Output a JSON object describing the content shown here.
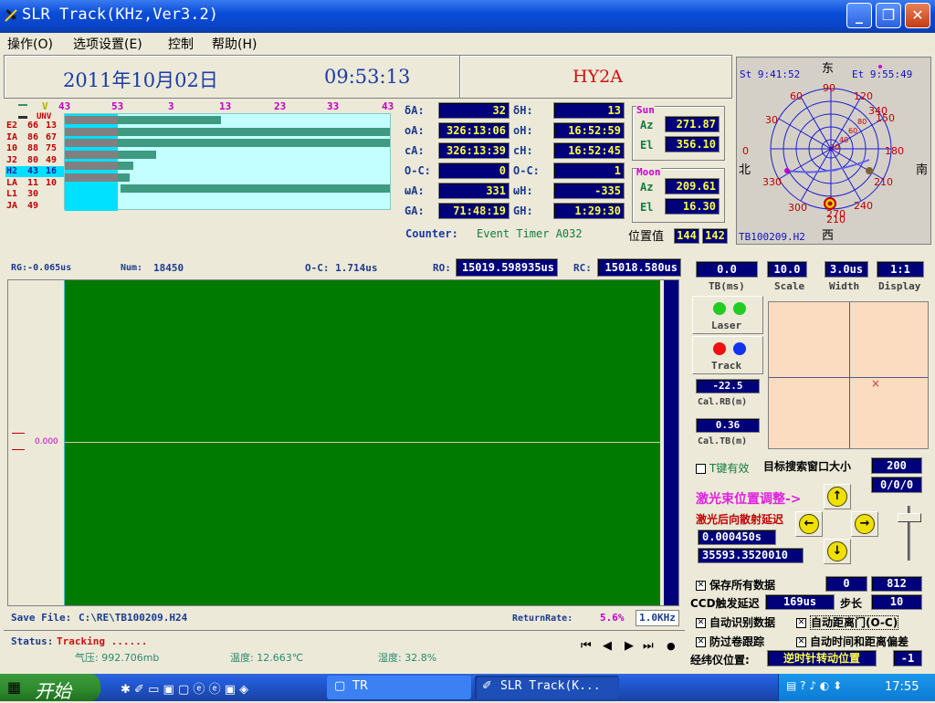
{
  "window": {
    "title": "SLR Track(KHz,Ver3.2)"
  },
  "menu": [
    "操作(O)",
    "选项设置(E)",
    "控制",
    "帮助(H)"
  ],
  "header": {
    "date": "2011年10月02日",
    "time": "09:53:13",
    "satellite": "HY2A"
  },
  "stations": {
    "col_v": "V",
    "col_unv": "UNV",
    "scale_labels": [
      "43",
      "53",
      "3",
      "13",
      "23",
      "33",
      "43"
    ],
    "rows": [
      {
        "name": "E2",
        "v": "66",
        "unv": "13",
        "bar": 0.48,
        "bar2": 0.0,
        "sel": false
      },
      {
        "name": "IA",
        "v": "86",
        "unv": "67",
        "bar": 1.0,
        "bar2": 0.0,
        "sel": false
      },
      {
        "name": "10",
        "v": "88",
        "unv": "75",
        "bar": 1.0,
        "bar2": 0.0,
        "sel": false
      },
      {
        "name": "J2",
        "v": "80",
        "unv": "49",
        "bar": 0.28,
        "bar2": 0.0,
        "sel": false
      },
      {
        "name": "H2",
        "v": "43",
        "unv": "16",
        "bar": 0.21,
        "bar2": 0.0,
        "sel": true
      },
      {
        "name": "LA",
        "v": "11",
        "unv": "10",
        "bar": 0.2,
        "bar2": 0.0,
        "sel": false
      },
      {
        "name": "L1",
        "v": "30",
        "unv": "",
        "bar": 0.0,
        "bar2": 0.83,
        "sel": false
      },
      {
        "name": "JA",
        "v": "49",
        "unv": "",
        "bar": 0.0,
        "bar2": 0.0,
        "sel": false
      }
    ]
  },
  "params": {
    "dA_label": "δA:",
    "dA": "32",
    "dH_label": "δH:",
    "dH": "13",
    "oA_label": "oA:",
    "oA": "326:13:06",
    "oH_label": "oH:",
    "oH": "16:52:59",
    "cA_label": "cA:",
    "cA": "326:13:39",
    "cH_label": "cH:",
    "cH": "16:52:45",
    "oc1_label": "O-C:",
    "oc1": "0",
    "oc2_label": "O-C:",
    "oc2": "1",
    "wA_label": "ωA:",
    "wA": "331",
    "wH_label": "ωH:",
    "wH": "-335",
    "GA_label": "GA:",
    "GA": "71:48:19",
    "GH_label": "GH:",
    "GH": "1:29:30",
    "counter_label": "Counter:",
    "counter_value": "Event Timer A032",
    "pos_label": "位置值",
    "pos1": "144",
    "pos2": "142"
  },
  "sun": {
    "label": "Sun",
    "az_label": "Az",
    "az": "271.87",
    "el_label": "El",
    "el": "356.10"
  },
  "moon": {
    "label": "Moon",
    "az_label": "Az",
    "az": "209.61",
    "el_label": "El",
    "el": "16.30"
  },
  "polar": {
    "start": "St  9:41:52",
    "end": "Et  9:55:49",
    "east": "东",
    "west": "西",
    "north": "北",
    "south": "南",
    "file": "TB100209.H2",
    "labels": [
      "90",
      "120",
      "60",
      "150",
      "30",
      "340",
      "180",
      "0",
      "210",
      "330",
      "300",
      "270",
      "240",
      "210",
      "80",
      "60",
      "40",
      "20"
    ]
  },
  "rangebar": {
    "rg": "RG:-0.065us",
    "num_label": "Num:",
    "num": "18450",
    "oc": "O-C: 1.714us",
    "ro_label": "RO:",
    "ro": "15019.598935us",
    "rc_label": "RC:",
    "rc": "15018.580us"
  },
  "scope": {
    "zero_label": "0.000"
  },
  "savefile": {
    "label": "Save File:",
    "path": "C:\\RE\\TB100209.H24",
    "rate_label": "ReturnRate:",
    "rate": "5.6%",
    "freq": "1.0KHz"
  },
  "status": {
    "label": "Status:",
    "value": "Tracking ......",
    "pressure": "气压: 992.706mb",
    "temperature": "温度: 12.663℃",
    "humidity": "湿度: 32.8%",
    "transport": [
      "⏮",
      "◀",
      "▶",
      "⏭",
      "●"
    ]
  },
  "controls": {
    "tb": "0.0",
    "tb_label": "TB(ms)",
    "scale": "10.0",
    "scale_label": "Scale",
    "width": "3.0us",
    "width_label": "Width",
    "display": "1:1",
    "display_label": "Display",
    "laser_label": "Laser",
    "track_label": "Track",
    "calrb": "-22.5",
    "calrb_label": "Cal.RB(m)",
    "caltb": "0.36",
    "caltb_label": "Cal.TB(m)",
    "tkey": "T键有效",
    "search_label": "目标搜索窗口大小",
    "search_value": "200",
    "search2": "0/0/0",
    "beam_label": "激光束位置调整->",
    "backscatter_label": "激光后向散射延迟",
    "delay1": "0.000450s",
    "delay2": "35593.3520010",
    "save_all": "保存所有数据",
    "save_v1": "0",
    "save_v2": "812",
    "ccd_label": "CCD触发延迟",
    "ccd_value": "169us",
    "step_label": "步长",
    "step_value": "10",
    "auto_id": "自动识别数据",
    "auto_gate": "自动距离门(O-C)",
    "anti_wind": "防过卷跟踪",
    "auto_time": "自动时间和距离偏差",
    "theo_label": "经纬仪位置:",
    "theo_value": "逆时针转动位置",
    "theo_num": "-1",
    "colors": {
      "laser": "#22cc22",
      "track_red": "#ee1111",
      "track_blue": "#1133ee",
      "beam_label": "#e020e0",
      "backscatter_label": "#c00000"
    }
  },
  "taskbar": {
    "start": "开始",
    "items": [
      {
        "label": "TR"
      },
      {
        "label": "SLR Track(K..."
      }
    ],
    "clock": "17:55"
  }
}
